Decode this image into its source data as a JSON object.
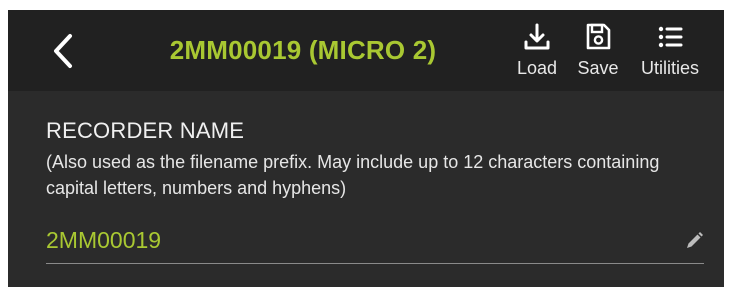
{
  "header": {
    "title": "2MM00019 (MICRO 2)",
    "back_icon": "chevron-left-icon",
    "actions": [
      {
        "label": "Load",
        "icon": "download-icon"
      },
      {
        "label": "Save",
        "icon": "save-icon"
      },
      {
        "label": "Utilities",
        "icon": "list-icon"
      }
    ]
  },
  "recorder_name": {
    "heading": "RECORDER NAME",
    "description": "(Also used as the filename prefix. May include up to 12 characters containing capital letters, numbers and hyphens)",
    "value": "2MM00019",
    "edit_icon": "pencil-icon"
  },
  "colors": {
    "accent": "#a9c832",
    "header_bg": "#212121",
    "body_bg": "#2b2b2b",
    "text": "#f0f0f0"
  }
}
